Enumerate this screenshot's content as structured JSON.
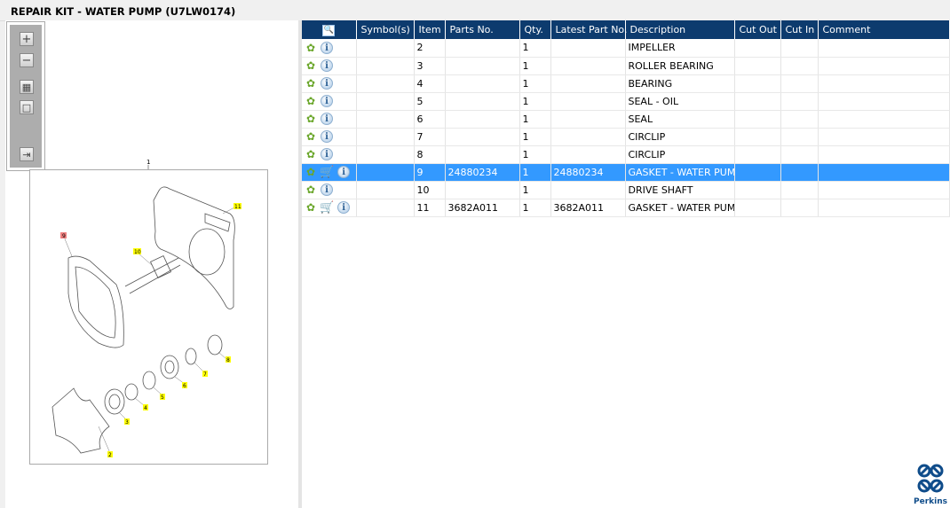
{
  "title": "REPAIR KIT - WATER PUMP (U7LW0174)",
  "toolbar": {
    "zoom_in": "+",
    "zoom_out": "−",
    "fit": "▦",
    "actual": "□",
    "export": "⇥"
  },
  "diagram": {
    "top_label": "1",
    "callouts": [
      "11",
      "9",
      "10",
      "8",
      "7",
      "6",
      "5",
      "4",
      "3",
      "2"
    ],
    "highlight_color": "#ffff00",
    "selected_color": "#f08080"
  },
  "table": {
    "headers": [
      "",
      "Symbol(s)",
      "Item",
      "Parts No.",
      "Qty.",
      "Latest Part No.",
      "Description",
      "Cut Out",
      "Cut In",
      "Comment"
    ],
    "rows": [
      {
        "item": "2",
        "parts_no": "",
        "qty": "1",
        "latest": "",
        "desc": "IMPELLER",
        "cart": false
      },
      {
        "item": "3",
        "parts_no": "",
        "qty": "1",
        "latest": "",
        "desc": "ROLLER BEARING",
        "cart": false
      },
      {
        "item": "4",
        "parts_no": "",
        "qty": "1",
        "latest": "",
        "desc": "BEARING",
        "cart": false
      },
      {
        "item": "5",
        "parts_no": "",
        "qty": "1",
        "latest": "",
        "desc": "SEAL - OIL",
        "cart": false
      },
      {
        "item": "6",
        "parts_no": "",
        "qty": "1",
        "latest": "",
        "desc": "SEAL",
        "cart": false
      },
      {
        "item": "7",
        "parts_no": "",
        "qty": "1",
        "latest": "",
        "desc": "CIRCLIP",
        "cart": false
      },
      {
        "item": "8",
        "parts_no": "",
        "qty": "1",
        "latest": "",
        "desc": "CIRCLIP",
        "cart": false
      },
      {
        "item": "9",
        "parts_no": "24880234",
        "qty": "1",
        "latest": "24880234",
        "desc": "GASKET - WATER PUMP",
        "cart": true,
        "selected": true
      },
      {
        "item": "10",
        "parts_no": "",
        "qty": "1",
        "latest": "",
        "desc": "DRIVE SHAFT",
        "cart": false
      },
      {
        "item": "11",
        "parts_no": "3682A011",
        "qty": "1",
        "latest": "3682A011",
        "desc": "GASKET - WATER PUMP",
        "cart": true
      }
    ]
  },
  "logo": {
    "name": "Perkins"
  },
  "colors": {
    "header": "#0d3b6e",
    "selected": "#3399ff",
    "gear": "#6aa62a"
  }
}
